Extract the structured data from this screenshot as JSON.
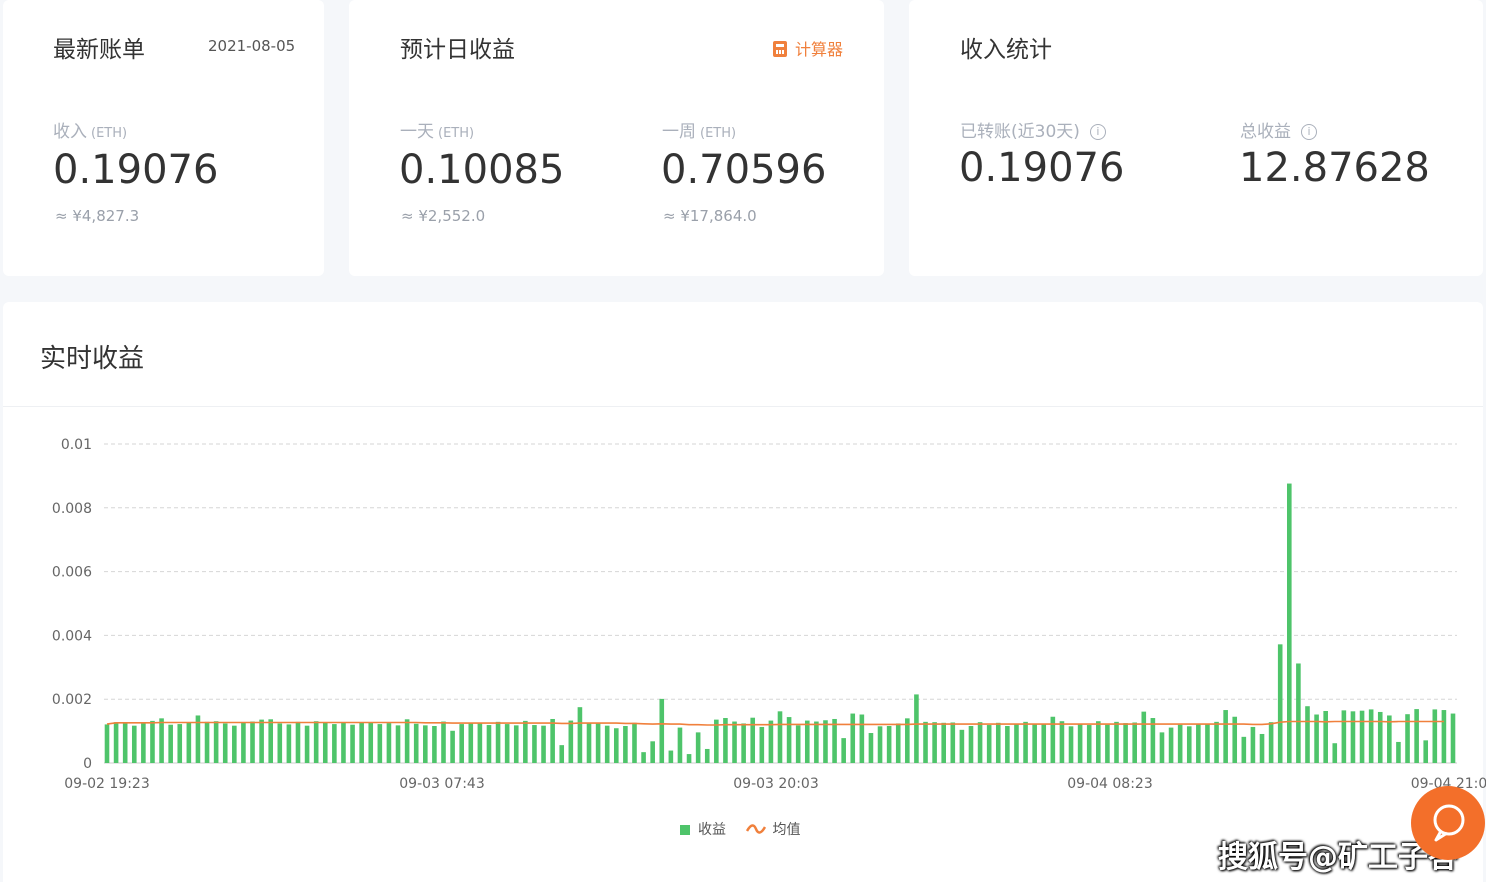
{
  "latest_bill": {
    "title": "最新账单",
    "date": "2021-08-05",
    "income_label": "收入",
    "unit": "(ETH)",
    "income_value": "0.19076",
    "income_cny": "≈ ¥4,827.3"
  },
  "daily_estimate": {
    "title": "预计日收益",
    "calculator_label": "计算器",
    "day_label": "一天",
    "day_unit": "(ETH)",
    "day_value": "0.10085",
    "day_cny": "≈ ¥2,552.0",
    "week_label": "一周",
    "week_unit": "(ETH)",
    "week_value": "0.70596",
    "week_cny": "≈ ¥17,864.0"
  },
  "income_stats": {
    "title": "收入统计",
    "transferred_label": "已转账(近30天)",
    "transferred_value": "0.19076",
    "total_label": "总收益",
    "total_value": "12.87628",
    "info_icon": "info-circle-icon"
  },
  "realtime": {
    "title": "实时收益"
  },
  "chart_data": {
    "type": "bar",
    "title": "",
    "xlabel": "",
    "ylabel": "",
    "ylim": [
      0,
      0.01
    ],
    "yticks": [
      "0",
      "0.002",
      "0.004",
      "0.006",
      "0.008",
      "0.01"
    ],
    "xticks": [
      "09-02 19:23",
      "09-03 07:43",
      "09-03 20:03",
      "09-04 08:23",
      "09-04 21:0"
    ],
    "grid": true,
    "legend_position": "bottom-center",
    "colors": {
      "bar": "#4ec46a",
      "line": "#f0803c"
    },
    "series": [
      {
        "name": "收益",
        "type": "bar",
        "values": [
          0.00121,
          0.00128,
          0.00126,
          0.00117,
          0.00128,
          0.00132,
          0.0014,
          0.0012,
          0.00122,
          0.00127,
          0.00149,
          0.00129,
          0.00131,
          0.00124,
          0.00117,
          0.00128,
          0.0013,
          0.00136,
          0.00137,
          0.00124,
          0.00121,
          0.00129,
          0.00117,
          0.00131,
          0.00128,
          0.00122,
          0.00128,
          0.0012,
          0.00126,
          0.00128,
          0.00122,
          0.00125,
          0.00118,
          0.00137,
          0.00123,
          0.00118,
          0.00116,
          0.0013,
          0.00101,
          0.00122,
          0.00124,
          0.00125,
          0.00119,
          0.00129,
          0.00122,
          0.00118,
          0.00132,
          0.00119,
          0.00117,
          0.00138,
          0.00056,
          0.00133,
          0.00175,
          0.00127,
          0.00124,
          0.00117,
          0.00109,
          0.00116,
          0.00126,
          0.00034,
          0.00068,
          0.00201,
          0.00039,
          0.00111,
          0.00028,
          0.00096,
          0.00044,
          0.00136,
          0.00141,
          0.0013,
          0.00124,
          0.00142,
          0.00113,
          0.00133,
          0.00162,
          0.00144,
          0.00118,
          0.00133,
          0.0013,
          0.00134,
          0.00138,
          0.00078,
          0.00155,
          0.00152,
          0.00094,
          0.00115,
          0.00116,
          0.00124,
          0.0014,
          0.00215,
          0.00129,
          0.00128,
          0.00126,
          0.00127,
          0.00104,
          0.00116,
          0.00128,
          0.00119,
          0.00126,
          0.00116,
          0.00123,
          0.00129,
          0.00121,
          0.00122,
          0.00145,
          0.00131,
          0.00115,
          0.00122,
          0.00119,
          0.00131,
          0.0012,
          0.00129,
          0.00125,
          0.00127,
          0.00161,
          0.00141,
          0.00096,
          0.00111,
          0.0012,
          0.00115,
          0.00121,
          0.00123,
          0.00129,
          0.00166,
          0.00145,
          0.00082,
          0.00113,
          0.00091,
          0.00128,
          0.00372,
          0.00876,
          0.00312,
          0.00178,
          0.00152,
          0.00163,
          0.00062,
          0.00165,
          0.00162,
          0.00164,
          0.00168,
          0.0016,
          0.00149,
          0.00066,
          0.00153,
          0.00169,
          0.00071,
          0.00168,
          0.00166,
          0.00155
        ]
      },
      {
        "name": "均值",
        "type": "line",
        "values": [
          0.00122,
          0.00126,
          0.00126,
          0.00126,
          0.00126,
          0.00126,
          0.00127,
          0.00127,
          0.00127,
          0.00127,
          0.00127,
          0.00127,
          0.00127,
          0.00127,
          0.00127,
          0.00127,
          0.00127,
          0.00127,
          0.00127,
          0.00127,
          0.00127,
          0.00127,
          0.00127,
          0.00127,
          0.00127,
          0.00127,
          0.00127,
          0.00127,
          0.00127,
          0.00127,
          0.00127,
          0.00127,
          0.00127,
          0.00127,
          0.00127,
          0.00126,
          0.00126,
          0.00126,
          0.00125,
          0.00125,
          0.00125,
          0.00125,
          0.00125,
          0.00125,
          0.00125,
          0.00125,
          0.00125,
          0.00125,
          0.00125,
          0.00125,
          0.00124,
          0.00124,
          0.00125,
          0.00125,
          0.00125,
          0.00125,
          0.00125,
          0.00124,
          0.00124,
          0.00123,
          0.00122,
          0.00123,
          0.00122,
          0.00122,
          0.0012,
          0.0012,
          0.00119,
          0.00119,
          0.0012,
          0.0012,
          0.0012,
          0.0012,
          0.0012,
          0.0012,
          0.00121,
          0.00121,
          0.00121,
          0.00121,
          0.00121,
          0.00121,
          0.00121,
          0.00121,
          0.00121,
          0.00121,
          0.00121,
          0.00121,
          0.00121,
          0.00121,
          0.00121,
          0.00122,
          0.00122,
          0.00122,
          0.00122,
          0.00122,
          0.00122,
          0.00122,
          0.00122,
          0.00122,
          0.00122,
          0.00122,
          0.00122,
          0.00122,
          0.00122,
          0.00122,
          0.00122,
          0.00122,
          0.00122,
          0.00122,
          0.00122,
          0.00122,
          0.00122,
          0.00122,
          0.00122,
          0.00122,
          0.00122,
          0.00122,
          0.00122,
          0.00122,
          0.00122,
          0.00122,
          0.00122,
          0.00122,
          0.00122,
          0.00122,
          0.00122,
          0.00122,
          0.00121,
          0.00121,
          0.00123,
          0.00128,
          0.0013,
          0.0013,
          0.0013,
          0.0013,
          0.00129,
          0.0013,
          0.0013,
          0.0013,
          0.0013,
          0.0013,
          0.0013,
          0.00129,
          0.0013,
          0.0013,
          0.0013,
          0.0013,
          0.0013,
          0.0013
        ]
      }
    ]
  },
  "watermark": "搜狐号@矿工子答"
}
